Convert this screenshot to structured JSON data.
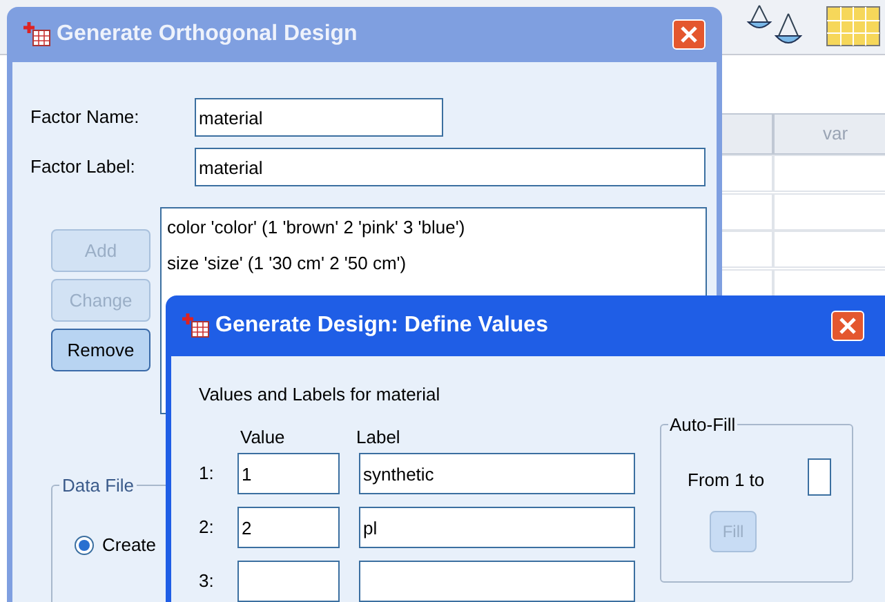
{
  "background_app": {
    "column_header": "var"
  },
  "orthogonal_dialog": {
    "title": "Generate Orthogonal Design",
    "factor_name": {
      "label": "Factor Name:",
      "value": "material"
    },
    "factor_label": {
      "label": "Factor Label:",
      "value": "material"
    },
    "factors": [
      {
        "text": "color 'color' (1 'brown' 2 'pink' 3 'blue')"
      },
      {
        "text": "size 'size' (1 '30 cm' 2 '50 cm')"
      }
    ],
    "buttons": [
      {
        "label": "Add",
        "disabled": true
      },
      {
        "label": "Change",
        "disabled": true
      },
      {
        "label": "Remove",
        "disabled": false
      }
    ],
    "data_file_group": "Data File",
    "create_option": {
      "label": "Create",
      "selected": true
    }
  },
  "values_dialog": {
    "title": "Generate Design: Define Values",
    "heading": "Values and Labels for material",
    "value_header": "Value",
    "label_header": "Label",
    "rows": [
      {
        "number": "1:",
        "value": "1",
        "label": "synthetic"
      },
      {
        "number": "2:",
        "value": "2",
        "label": "pl"
      },
      {
        "number": "3:",
        "value": "",
        "label": ""
      }
    ],
    "auto_fill": {
      "title": "Auto-Fill",
      "from_label": "From 1 to",
      "fill_button": {
        "label": "Fill",
        "disabled": true
      }
    }
  }
}
